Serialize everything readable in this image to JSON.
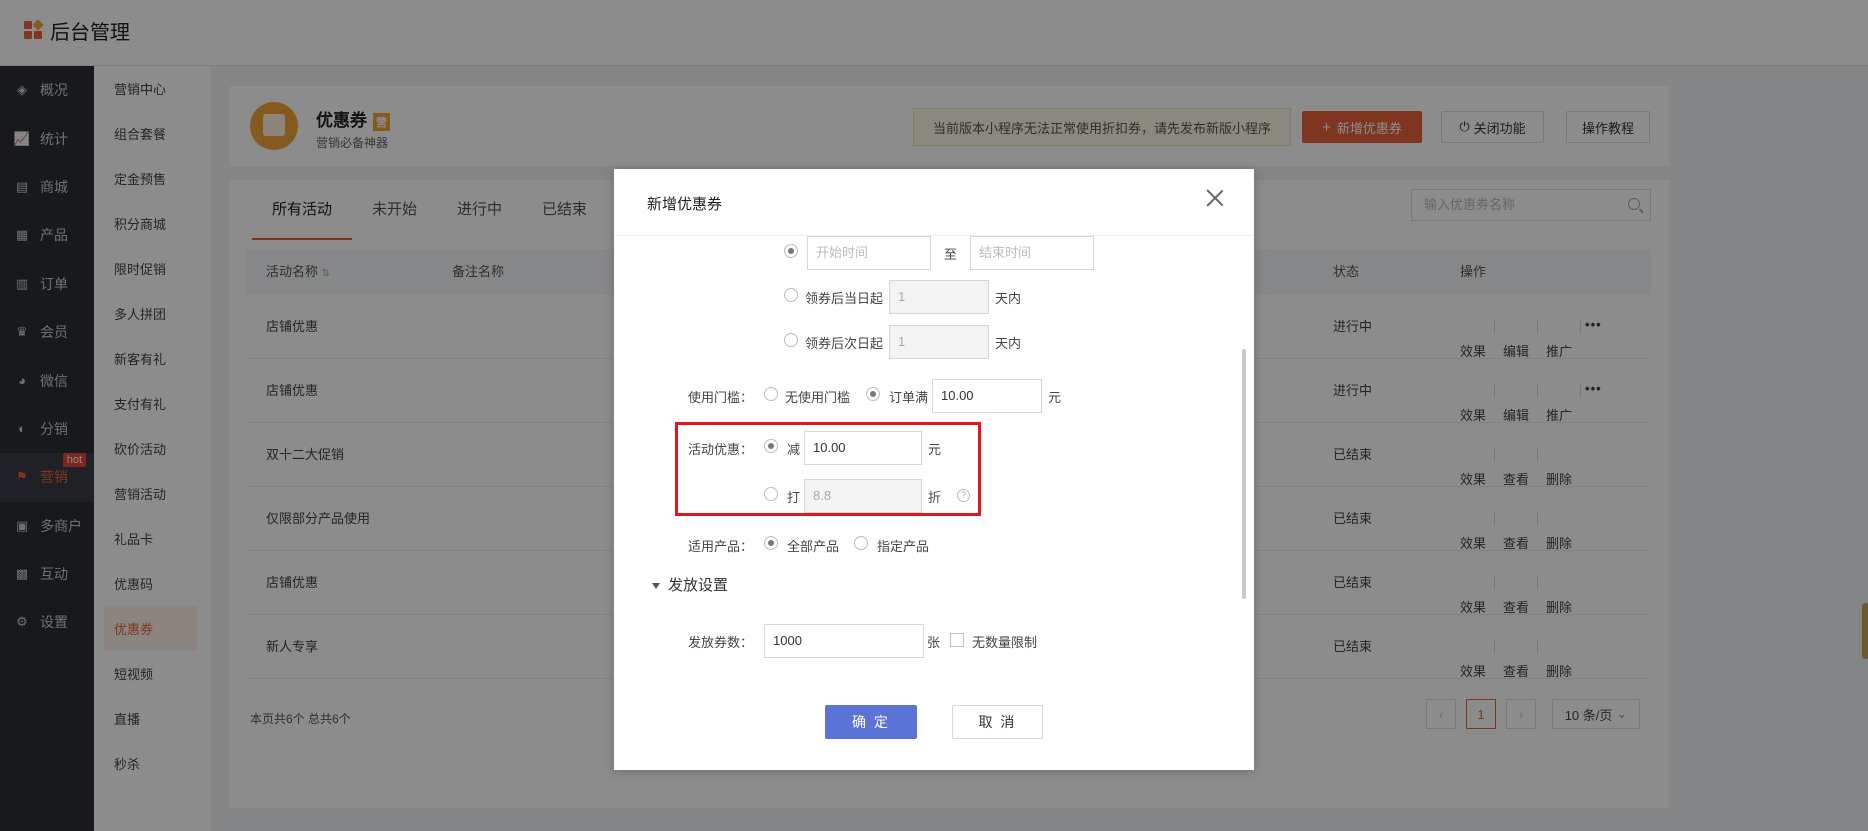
{
  "app": {
    "title": "后台管理"
  },
  "nav_primary": [
    {
      "label": "概况",
      "icon": "layers-icon"
    },
    {
      "label": "统计",
      "icon": "chart-icon"
    },
    {
      "label": "商城",
      "icon": "store-icon"
    },
    {
      "label": "产品",
      "icon": "grid-icon"
    },
    {
      "label": "订单",
      "icon": "clipboard-icon"
    },
    {
      "label": "会员",
      "icon": "crown-icon"
    },
    {
      "label": "微信",
      "icon": "wechat-icon"
    },
    {
      "label": "分销",
      "icon": "users-icon"
    },
    {
      "label": "营销",
      "icon": "flag-icon",
      "badge": "hot"
    },
    {
      "label": "多商户",
      "icon": "shop-icon"
    },
    {
      "label": "互动",
      "icon": "interaction-icon"
    },
    {
      "label": "设置",
      "icon": "gear-icon"
    }
  ],
  "nav_secondary": [
    "营销中心",
    "组合套餐",
    "定金预售",
    "积分商城",
    "限时促销",
    "多人拼团",
    "新客有礼",
    "支付有礼",
    "砍价活动",
    "营销活动",
    "礼品卡",
    "优惠码",
    "优惠券",
    "短视频",
    "直播",
    "秒杀"
  ],
  "header": {
    "title": "优惠券",
    "badge": "营",
    "subtitle": "营销必备神器",
    "notice": "当前版本小程序无法正常使用折扣券，请先发布新版小程序",
    "add_btn": "新增优惠券",
    "close_btn": "关闭功能",
    "guide_btn": "操作教程"
  },
  "tabs": [
    "所有活动",
    "未开始",
    "进行中",
    "已结束"
  ],
  "search_placeholder": "输入优惠券名称",
  "table": {
    "headers": {
      "name": "活动名称",
      "remark": "备注名称",
      "status": "状态",
      "ops": "操作"
    },
    "rows": [
      {
        "name": "店铺优惠",
        "status": "进行中",
        "ops": [
          "效果",
          "编辑",
          "推广"
        ],
        "more": "•••"
      },
      {
        "name": "店铺优惠",
        "status": "进行中",
        "ops": [
          "效果",
          "编辑",
          "推广"
        ],
        "more": "•••"
      },
      {
        "name": "双十二大促销",
        "status": "已结束",
        "ops": [
          "效果",
          "查看",
          "删除"
        ]
      },
      {
        "name": "仅限部分产品使用",
        "status": "已结束",
        "ops": [
          "效果",
          "查看",
          "删除"
        ]
      },
      {
        "name": "店铺优惠",
        "status": "已结束",
        "ops": [
          "效果",
          "查看",
          "删除"
        ]
      },
      {
        "name": "新人专享",
        "status": "已结束",
        "ops": [
          "效果",
          "查看",
          "删除"
        ]
      }
    ]
  },
  "footer": {
    "info": "本页共6个 总共6个",
    "current_page": "1",
    "page_size": "10 条/页"
  },
  "modal": {
    "title": "新增优惠券",
    "start_placeholder": "开始时间",
    "to": "至",
    "end_placeholder": "结束时间",
    "same_day_label": "领券后当日起",
    "same_day_value": "1",
    "next_day_label": "领券后次日起",
    "next_day_value": "1",
    "days_within": "天内",
    "threshold_label": "使用门槛：",
    "no_threshold": "无使用门槛",
    "order_full": "订单满",
    "threshold_value": "10.00",
    "yuan": "元",
    "discount_label": "活动优惠：",
    "reduce": "减",
    "reduce_value": "10.00",
    "discount": "打",
    "discount_value": "8.8",
    "zhe": "折",
    "help": "?",
    "product_label": "适用产品：",
    "all_products": "全部产品",
    "specific_products": "指定产品",
    "section_title": "发放设置",
    "issue_label": "发放券数：",
    "issue_value": "1000",
    "zhang": "张",
    "unlimited": "无数量限制",
    "ok": "确 定",
    "cancel": "取 消"
  }
}
